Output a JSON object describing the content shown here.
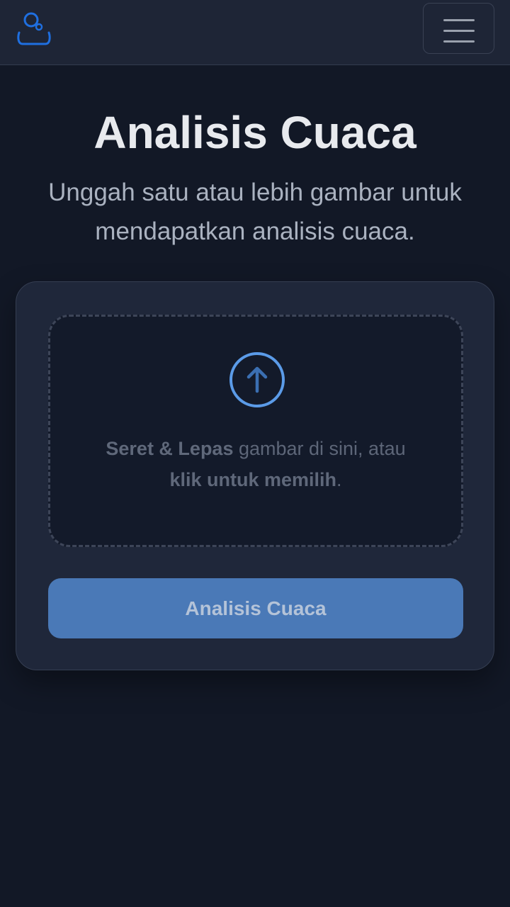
{
  "nav": {
    "logo_icon": "user-weather-logo-icon",
    "menu_icon": "hamburger-menu-icon"
  },
  "hero": {
    "title": "Analisis Cuaca",
    "subtitle": "Unggah satu atau lebih gambar untuk mendapatkan analisis cuaca."
  },
  "upload": {
    "icon": "upload-arrow-icon",
    "text_bold_1": "Seret & Lepas",
    "text_mid": " gambar di sini, atau ",
    "text_bold_2": "klik untuk memilih",
    "text_end": "."
  },
  "actions": {
    "analyze_label": "Analisis Cuaca"
  },
  "colors": {
    "background": "#121826",
    "accent": "#4a79b7",
    "icon_blue": "#5b9be8"
  }
}
